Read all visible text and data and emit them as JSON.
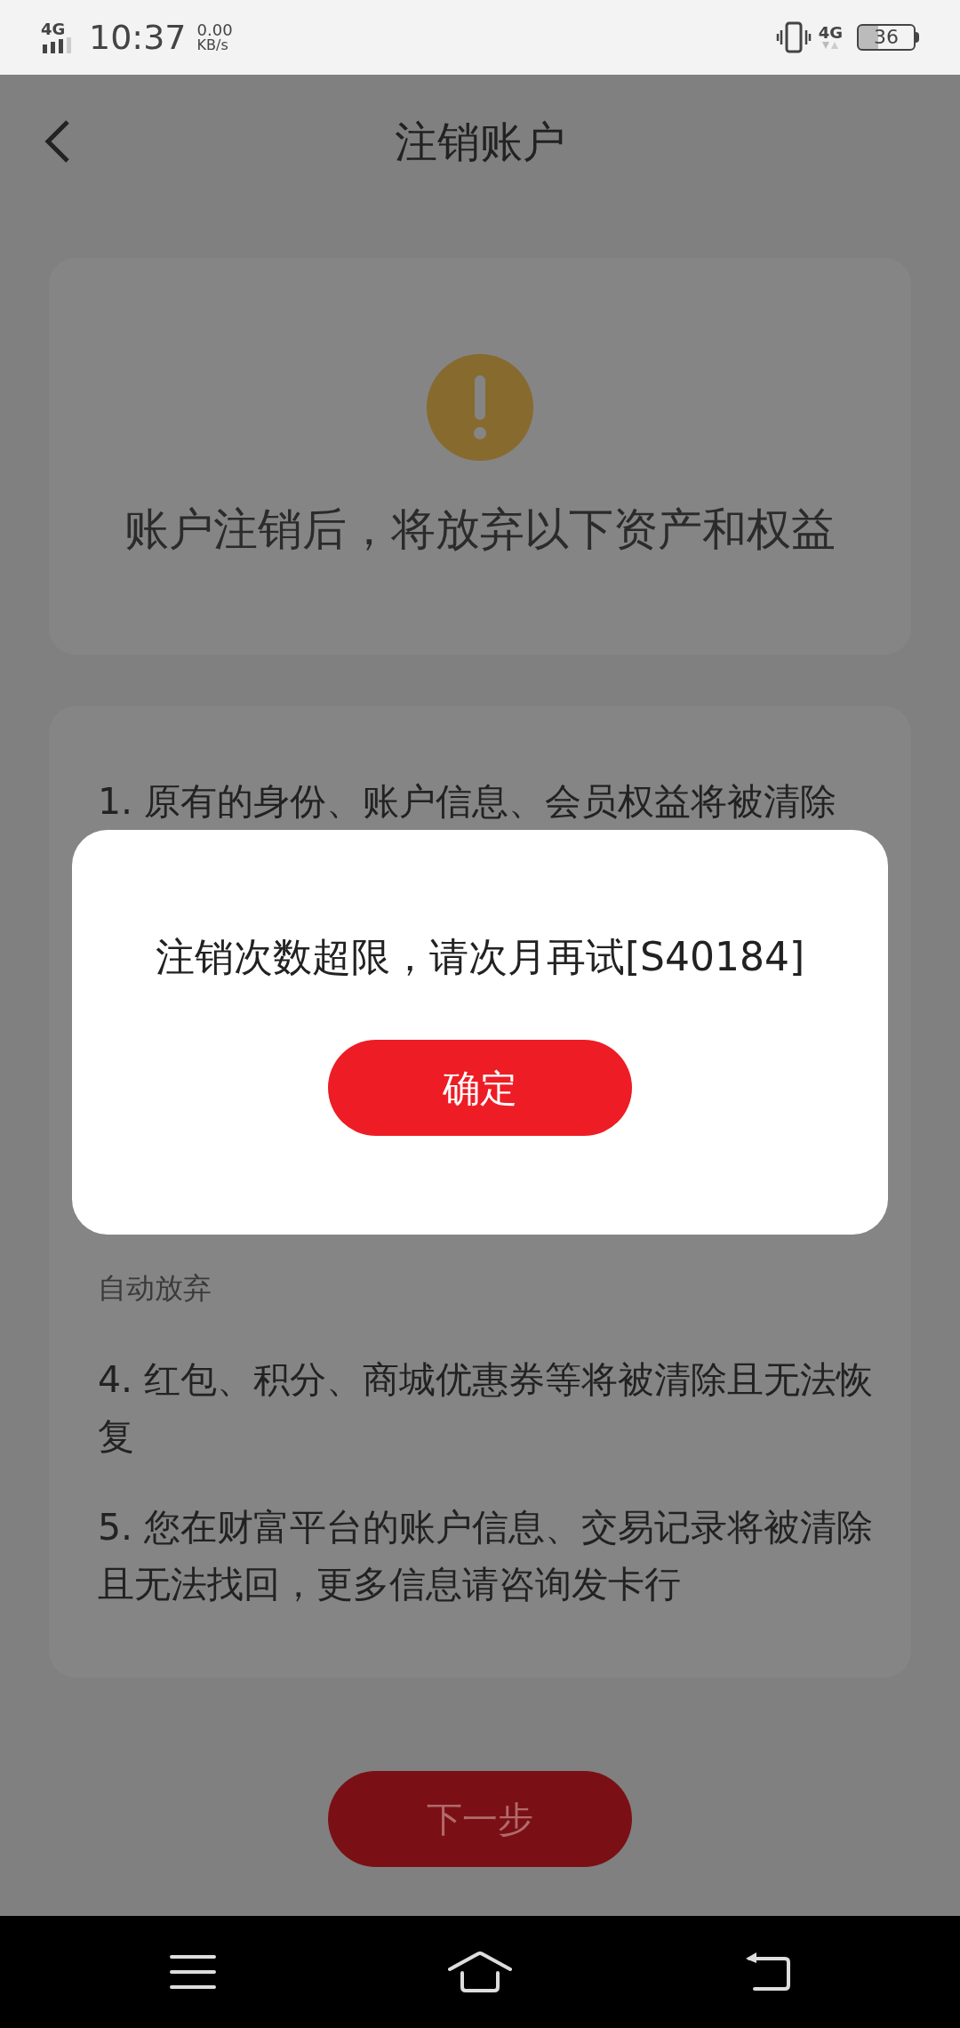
{
  "status_bar": {
    "network": "4G",
    "time": "10:37",
    "speed_value": "0.00",
    "speed_unit": "KB/s",
    "network_right": "4G",
    "battery": "36"
  },
  "header": {
    "title": "注销账户"
  },
  "warning_card": {
    "heading": "账户注销后，将放弃以下资产和权益"
  },
  "terms": [
    {
      "text": "1. 原有的身份、账户信息、会员权益将被清除"
    },
    {
      "text": "自动放弃"
    },
    {
      "text": "4. 红包、积分、商城优惠券等将被清除且无法恢复"
    },
    {
      "text": "5. 您在财富平台的账户信息、交易记录将被清除且无法找回，更多信息请咨询发卡行"
    }
  ],
  "next_button": {
    "label": "下一步",
    "disabled": true
  },
  "dialog": {
    "message": "注销次数超限，请次月再试[S40184]",
    "confirm": "确定"
  }
}
